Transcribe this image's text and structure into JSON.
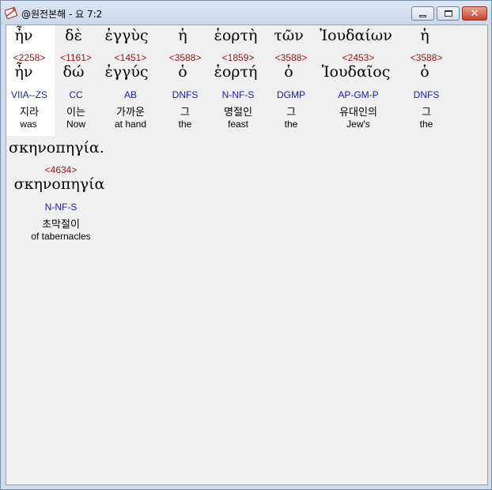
{
  "window": {
    "title": "@원전본해 - 요 7:2"
  },
  "words": [
    {
      "surface": "ἦν",
      "strong": "<2258>",
      "lemma": "ἦν",
      "morph": "VIIA--ZS",
      "korean": "지라",
      "english": "was"
    },
    {
      "surface": "δὲ",
      "strong": "<1161>",
      "lemma": "δώ",
      "morph": "CC",
      "korean": "이는",
      "english": "Now"
    },
    {
      "surface": "ἐγγὺς",
      "strong": "<1451>",
      "lemma": "ἐγγύς",
      "morph": "AB",
      "korean": "가까운",
      "english": "at hand"
    },
    {
      "surface": "ἡ",
      "strong": "<3588>",
      "lemma": "ὁ",
      "morph": "DNFS",
      "korean": "그",
      "english": "the"
    },
    {
      "surface": "ἑορτὴ",
      "strong": "<1859>",
      "lemma": "ἑορτή",
      "morph": "N-NF-S",
      "korean": "명절인",
      "english": "feast"
    },
    {
      "surface": "τῶν",
      "strong": "<3588>",
      "lemma": "ὁ",
      "morph": "DGMP",
      "korean": "그",
      "english": "the"
    },
    {
      "surface": "Ἰουδαίων",
      "strong": "<2453>",
      "lemma": "Ἰουδαῖος",
      "morph": "AP-GM-P",
      "korean": "유대인의",
      "english": "Jew's"
    },
    {
      "surface": "ἡ",
      "strong": "<3588>",
      "lemma": "ὁ",
      "morph": "DNFS",
      "korean": "그",
      "english": "the"
    },
    {
      "surface": "σκηνοπηγία.",
      "strong": "<4634>",
      "lemma": "σκηνοπηγία",
      "morph": "N-NF-S",
      "korean": "초막절이",
      "english": "of tabernacles"
    }
  ]
}
